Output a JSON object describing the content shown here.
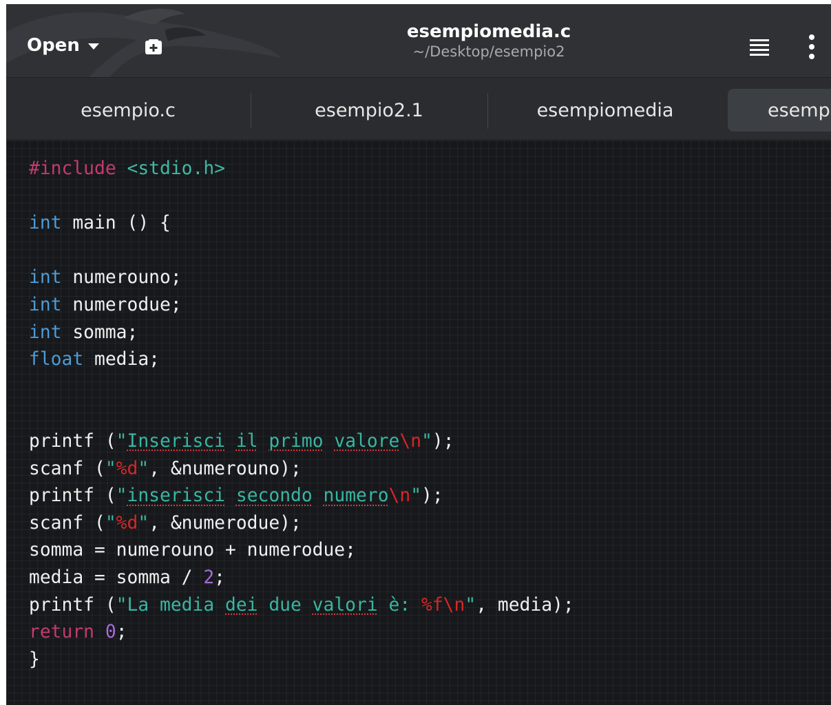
{
  "header": {
    "open_label": "Open",
    "title": "esempiomedia.c",
    "subtitle": "~/Desktop/esempio2",
    "icons": [
      "chevron-down-icon",
      "new-tab-icon",
      "hamburger-menu-icon",
      "kebab-menu-icon"
    ]
  },
  "tabs": [
    {
      "label": "esempio.c"
    },
    {
      "label": "esempio2.1"
    },
    {
      "label": "esempiomedia"
    },
    {
      "label": "esempi"
    }
  ],
  "editor": {
    "lines": [
      "#include <stdio.h>",
      "",
      "int main () {",
      "",
      "int numerouno;",
      "int numerodue;",
      "int somma;",
      "float media;",
      "",
      "",
      "printf (\"Inserisci il primo valore\\n\");",
      "scanf (\"%d\", &numerouno);",
      "printf (\"inserisci secondo numero\\n\");",
      "scanf (\"%d\", &numerodue);",
      "somma = numerouno + numerodue;",
      "media = somma / 2;",
      "printf (\"La media dei due valori è: %f\\n\", media);",
      "return 0;",
      "}"
    ],
    "colors": {
      "keyword": "#4d9bd6",
      "preprocessor": "#c43a6e",
      "string": "#39b6a2",
      "escape": "#d82626",
      "number": "#a66ad6",
      "text": "#f0f0f0"
    }
  }
}
